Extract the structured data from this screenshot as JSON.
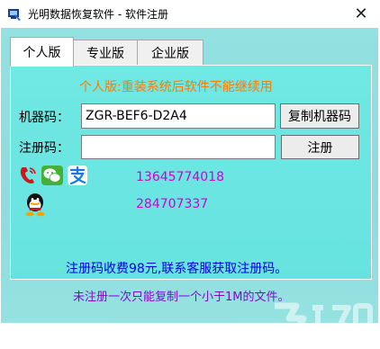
{
  "window": {
    "title": "光明数据恢复软件 - 软件注册",
    "close_glyph": "✕",
    "icon": "app-icon"
  },
  "tabs": [
    {
      "label": "个人版",
      "active": true
    },
    {
      "label": "专业版",
      "active": false
    },
    {
      "label": "企业版",
      "active": false
    }
  ],
  "panel": {
    "warning": "个人版:重装系统后软件不能继续用",
    "machine_code_label": "机器码：",
    "machine_code_value": "ZGR-BEF6-D2A4",
    "copy_button": "复制机器码",
    "reg_code_label": "注册码：",
    "reg_code_value": "",
    "register_button": "注册"
  },
  "contact": {
    "icons": [
      "phone-icon",
      "wechat-icon",
      "alipay-icon",
      "qq-icon"
    ],
    "phone": "13645774018",
    "qq": "284707337"
  },
  "footer": {
    "price_text": "注册码收费98元,联系客服获取注册码。",
    "limit_note": "未注册一次只能复制一个小于1M的文件。"
  },
  "colors": {
    "warning": "#ff7a00",
    "contact": "#d200d2",
    "price": "#0000e8",
    "note": "#7d0ec8",
    "background": "#93e1e0",
    "panel": "#6ae5e1"
  }
}
